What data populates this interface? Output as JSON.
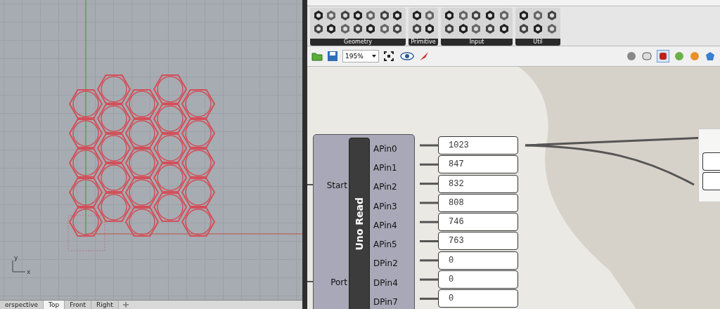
{
  "viewport": {
    "axis_labels": [
      "y",
      "x"
    ],
    "tabs": [
      {
        "label": "erspective",
        "selected": false
      },
      {
        "label": "Top",
        "selected": true
      },
      {
        "label": "Front",
        "selected": false
      },
      {
        "label": "Right",
        "selected": false
      }
    ]
  },
  "ribbon": {
    "groups": [
      {
        "label": "Geometry"
      },
      {
        "label": "Primitive"
      },
      {
        "label": "Input"
      },
      {
        "label": "Util"
      }
    ]
  },
  "toolbar": {
    "zoom": "195%"
  },
  "component": {
    "title": "Uno Read",
    "inputs": [
      "Start",
      "Port"
    ],
    "outputs": [
      {
        "name": "APin0",
        "value": "1023"
      },
      {
        "name": "APin1",
        "value": "847"
      },
      {
        "name": "APin2",
        "value": "832"
      },
      {
        "name": "APin3",
        "value": "808"
      },
      {
        "name": "APin4",
        "value": "746"
      },
      {
        "name": "APin5",
        "value": "763"
      },
      {
        "name": "DPin2",
        "value": "0"
      },
      {
        "name": "DPin4",
        "value": "0"
      },
      {
        "name": "DPin7",
        "value": "0"
      }
    ]
  }
}
